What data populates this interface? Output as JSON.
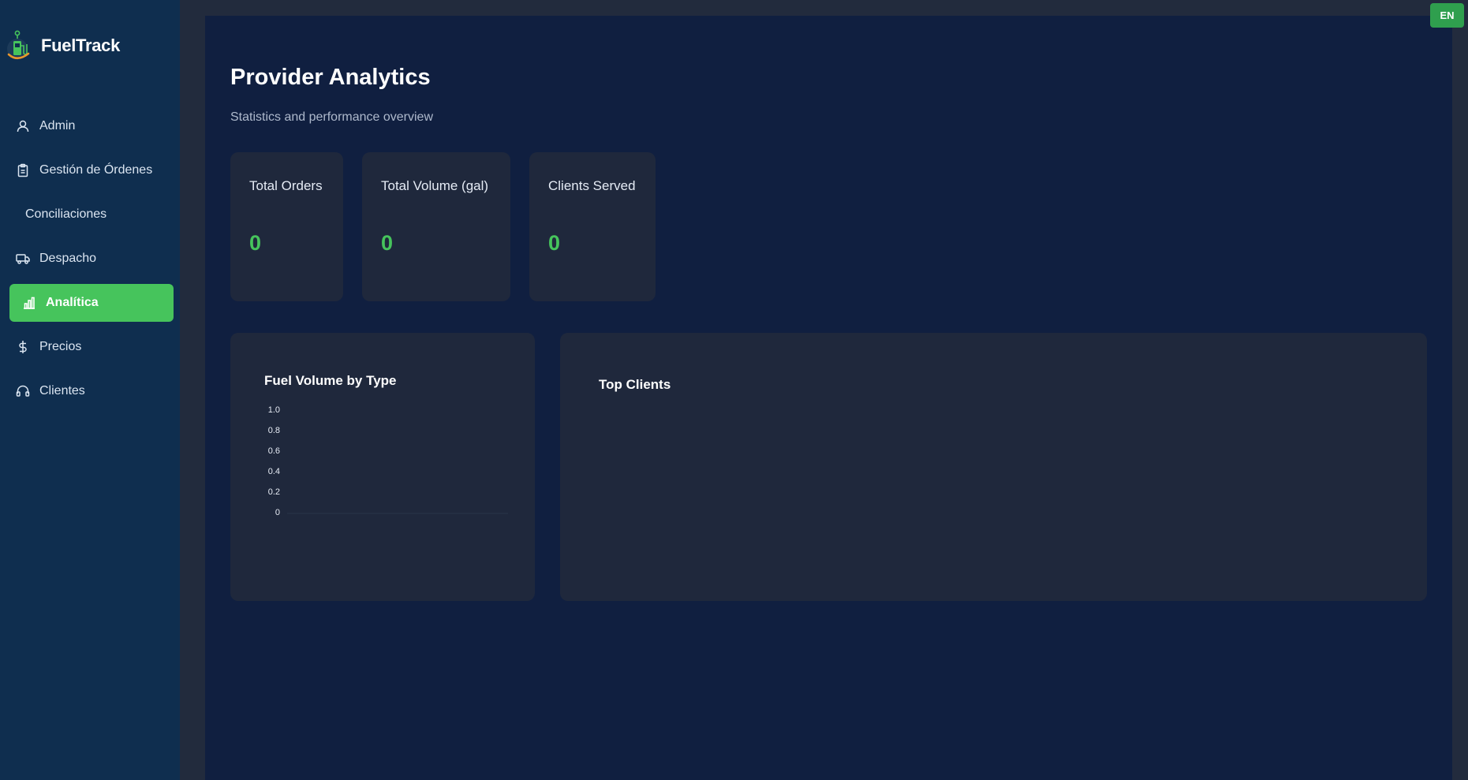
{
  "brand": {
    "name": "FuelTrack",
    "logo_icon": "fuel-pump-logo-icon"
  },
  "sidebar": {
    "items": [
      {
        "label": "Admin",
        "icon": "user-icon",
        "active": false
      },
      {
        "label": "Gestión de Órdenes",
        "icon": "clipboard-icon",
        "active": false
      },
      {
        "label": "Conciliaciones",
        "icon": "",
        "active": false
      },
      {
        "label": "Despacho",
        "icon": "truck-icon",
        "active": false
      },
      {
        "label": "Analítica",
        "icon": "bar-chart-icon",
        "active": true
      },
      {
        "label": "Precios",
        "icon": "dollar-icon",
        "active": false
      },
      {
        "label": "Clientes",
        "icon": "headset-icon",
        "active": false
      }
    ]
  },
  "header": {
    "title": "Provider Analytics",
    "subtitle": "Statistics and performance overview"
  },
  "stats": [
    {
      "label": "Total Orders",
      "value": "0"
    },
    {
      "label": "Total Volume (gal)",
      "value": "0"
    },
    {
      "label": "Clients Served",
      "value": "0"
    }
  ],
  "fuel_chart": {
    "title": "Fuel Volume by Type",
    "ticks": [
      "1.0",
      "0.8",
      "0.6",
      "0.4",
      "0.2",
      "0"
    ]
  },
  "top_clients": {
    "title": "Top Clients"
  },
  "language": {
    "label": "EN"
  },
  "colors": {
    "accent": "#46c45c",
    "sidebar_bg": "#0f2e4f",
    "main_bg": "#101f40",
    "card_bg": "#1f283c"
  },
  "chart_data": {
    "type": "bar",
    "title": "Fuel Volume by Type",
    "categories": [],
    "values": [],
    "ylim": [
      0,
      1.0
    ],
    "yticks": [
      0,
      0.2,
      0.4,
      0.6,
      0.8,
      1.0
    ],
    "xlabel": "",
    "ylabel": "",
    "grid": false
  }
}
